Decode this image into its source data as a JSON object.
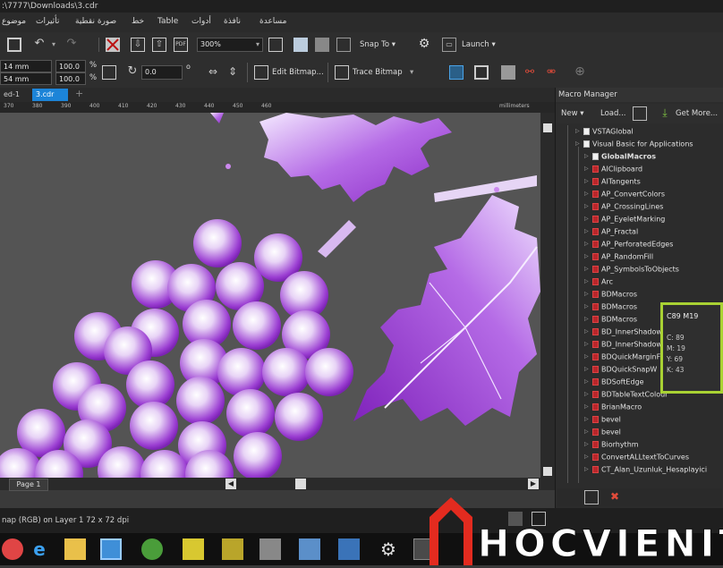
{
  "window": {
    "title": ":\\7777\\Downloads\\3.cdr"
  },
  "menu": {
    "items": [
      "موضوع",
      "تأثيرات",
      "صورة نقطية",
      "خط",
      "Table",
      "أدوات",
      "نافذة",
      "مساعدة"
    ]
  },
  "toolbar": {
    "zoom": "300%",
    "snap_label": "Snap To",
    "launch_label": "Launch"
  },
  "propbar": {
    "width": "14 mm",
    "height": "54 mm",
    "scale_x": "100.0",
    "scale_y": "100.0",
    "unit_pct": "%",
    "angle": "0.0",
    "degree": "o",
    "edit_bitmap": "Edit Bitmap...",
    "trace_bitmap": "Trace Bitmap"
  },
  "tabs": [
    {
      "label": "ed-1",
      "active": false
    },
    {
      "label": "3.cdr",
      "active": true
    }
  ],
  "ruler": {
    "ticks": [
      "370",
      "380",
      "390",
      "400",
      "410",
      "420",
      "430",
      "440",
      "450",
      "460"
    ],
    "unit": "millimeters"
  },
  "page_nav": {
    "page_label": "Page 1"
  },
  "macro_manager": {
    "title": "Macro Manager",
    "new_label": "New",
    "load_label": "Load...",
    "get_more_label": "Get More...",
    "tree": [
      {
        "label": "VSTAGlobal",
        "level": 1,
        "icon": "folder",
        "bold": false
      },
      {
        "label": "Visual Basic for Applications",
        "level": 1,
        "icon": "folder",
        "bold": false
      },
      {
        "label": "GlobalMacros",
        "level": 2,
        "icon": "white",
        "bold": true
      },
      {
        "label": "AIClipboard",
        "level": 2,
        "icon": "red",
        "bold": false
      },
      {
        "label": "AITangents",
        "level": 2,
        "icon": "red",
        "bold": false
      },
      {
        "label": "AP_ConvertColors",
        "level": 2,
        "icon": "red",
        "bold": false
      },
      {
        "label": "AP_CrossingLines",
        "level": 2,
        "icon": "red",
        "bold": false
      },
      {
        "label": "AP_EyeletMarking",
        "level": 2,
        "icon": "red",
        "bold": false
      },
      {
        "label": "AP_Fractal",
        "level": 2,
        "icon": "red",
        "bold": false
      },
      {
        "label": "AP_PerforatedEdges",
        "level": 2,
        "icon": "red",
        "bold": false
      },
      {
        "label": "AP_RandomFill",
        "level": 2,
        "icon": "red",
        "bold": false
      },
      {
        "label": "AP_SymbolsToObjects",
        "level": 2,
        "icon": "red",
        "bold": false
      },
      {
        "label": "Arc",
        "level": 2,
        "icon": "red",
        "bold": false
      },
      {
        "label": "BDMacros",
        "level": 2,
        "icon": "red",
        "bold": false
      },
      {
        "label": "BDMacros",
        "level": 2,
        "icon": "red",
        "bold": false
      },
      {
        "label": "BDMacros",
        "level": 2,
        "icon": "red",
        "bold": false
      },
      {
        "label": "BD_InnerShadow",
        "level": 2,
        "icon": "red",
        "bold": false
      },
      {
        "label": "BD_InnerShadow",
        "level": 2,
        "icon": "red",
        "bold": false
      },
      {
        "label": "BDQuickMarginFi",
        "level": 2,
        "icon": "red",
        "bold": false
      },
      {
        "label": "BDQuickSnapW",
        "level": 2,
        "icon": "red",
        "bold": false
      },
      {
        "label": "BDSoftEdge",
        "level": 2,
        "icon": "red",
        "bold": false
      },
      {
        "label": "BDTableTextColour",
        "level": 2,
        "icon": "red",
        "bold": false
      },
      {
        "label": "BrianMacro",
        "level": 2,
        "icon": "red",
        "bold": false
      },
      {
        "label": "bevel",
        "level": 2,
        "icon": "red",
        "bold": false
      },
      {
        "label": "bevel",
        "level": 2,
        "icon": "red",
        "bold": false
      },
      {
        "label": "Biorhythm",
        "level": 2,
        "icon": "red",
        "bold": false
      },
      {
        "label": "ConvertALLtextToCurves",
        "level": 2,
        "icon": "red",
        "bold": false
      },
      {
        "label": "CT_Alan_Uzunluk_Hesaplayici",
        "level": 2,
        "icon": "red",
        "bold": false
      }
    ]
  },
  "color_popup": {
    "title": "C89 M19",
    "c": "C: 89",
    "m": "M: 19",
    "y": "Y: 69",
    "k": "K: 43"
  },
  "status": {
    "text": "nap (RGB) on Layer 1 72 x 72 dpi"
  },
  "watermark": {
    "text": "HOCVIENIT"
  },
  "colors": {
    "accent": "#1c84d8",
    "grape": "#8e2fc6",
    "highlight_border": "#a9d233",
    "watermark_red": "#e32b1f"
  }
}
